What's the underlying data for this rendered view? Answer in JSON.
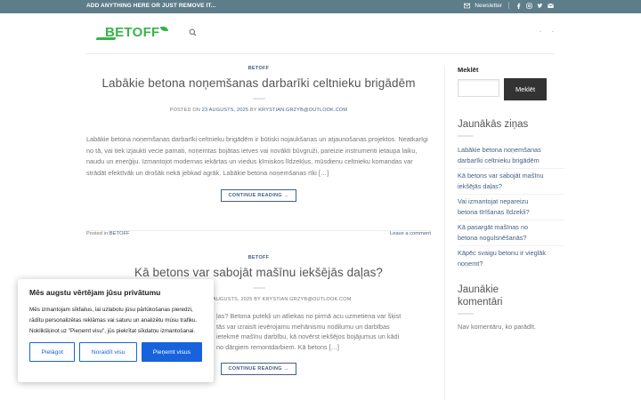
{
  "topbar": {
    "promo": "ADD ANYTHING HERE OR JUST REMOVE IT...",
    "newsletter": "Newsletter",
    "icons": [
      "envelope-icon",
      "facebook-icon",
      "instagram-icon",
      "twitter-icon",
      "mail-icon"
    ]
  },
  "header": {
    "logo_text": "BETOFF",
    "logo_color": "#37b34a",
    "right_dots": [
      "-",
      "-"
    ]
  },
  "posts": [
    {
      "category": "BETOFF",
      "title": "Labākie betona noņemšanas darbarīki celtnieku brigādēm",
      "meta_prefix": "POSTED ON",
      "date": "23 AUGUSTS, 2025",
      "by": "BY",
      "author": "KRYSTIAN.GRZYB@OUTLOOK.COM",
      "excerpt": "Labākie betona noņemšanas darbarīki celtnieku brigādēm ir būtiski nojaukšanas un atjaunošanas projektos. Neatkarīgi no tā, vai tiek izjaukti vecie pamati, noņemtas bojātas ietves vai novākti būvgruži, pareizie instrumenti ietaupa laiku, naudu un enerģiju. Izmantojot modernas iekārtas un viedus ķīmiskos līdzekļus, mūsdienu celtnieku komandas var strādāt efektīvāk un drošāk nekā jebkad agrāk. Labākie betona noņemšanas rīki […]",
      "button": "CONTINUE READING →",
      "posted_in": "Posted in",
      "posted_cat": "BETOFF",
      "comment": "Leave a comment"
    },
    {
      "category": "BETOFF",
      "title": "Kā betons var sabojāt mašīnu iekšējās daļas?",
      "meta_partial": "AUGUSTS, 2025 BY KRYSTIAN.GRZYB@OUTLOOK.COM",
      "excerpt_lines": [
        "ļas? Betona putekļi un atliekas no pirmā acu uzmetiena var šķist",
        "tās var izraisīt ievērojamu mehānismu nodilumu un darbības",
        "ietekmē mašīnu darbību, kā novērst iekšējos bojājumus un kādi",
        "no dārgiem remontdarbiem. Kā betons […]"
      ],
      "button": "CONTINUE READING →"
    }
  ],
  "sidebar": {
    "search_label": "Meklēt",
    "search_button": "Meklēt",
    "recent_heading": "Jaunākās ziņas",
    "recent_items": [
      [
        "Labākie betona noņemšanas",
        "darbarīki celtnieku brigādēm"
      ],
      [
        "Kā betons var sabojāt mašīnu",
        "iekšējās daļas?"
      ],
      [
        "Vai izmantojat nepareizu",
        "betona tīrīšanas līdzekli?"
      ],
      [
        "Kā pasargāt mašīnas no",
        "betona nogulsnēšanās?"
      ],
      [
        "Kāpēc svaigu betonu ir vieglāk",
        "noņemt?"
      ]
    ],
    "comments_heading_1": "Jaunākie",
    "comments_heading_2": "komentāri",
    "comments_note": "Nav komentāru, ko parādīt."
  },
  "cookie": {
    "title": "Mēs augstu vērtējam jūsu privātumu",
    "body": "Mēs izmantojam sīkfailus, lai uzlabotu jūsu pārlūkošanas pieredzi, rādītu personalizētas reklāmas vai saturu un analizētu mūsu trafiku. Noklikšķinot uz \"Pieņemt visu\", jūs piekrītat sīkdatņu izmantošanai.",
    "buttons": {
      "customize": "Pielāgot",
      "reject": "Noraidīt visu",
      "accept": "Pieņemt visus"
    },
    "accent": "#1863dc"
  },
  "colors": {
    "topbar": "#5e7d8a",
    "link": "#446084"
  }
}
